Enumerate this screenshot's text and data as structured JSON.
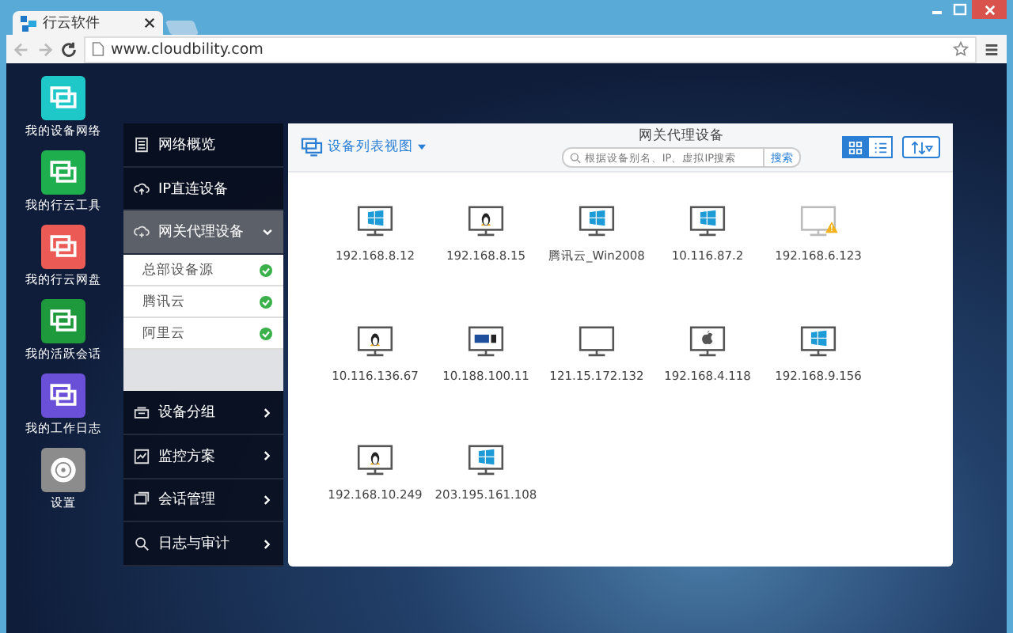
{
  "browser": {
    "tab_title": "行云软件",
    "url": "www.cloudbility.com"
  },
  "desktop_apps": [
    {
      "label": "我的设备网络",
      "color": "#1ec8c8"
    },
    {
      "label": "我的行云工具",
      "color": "#1fae4e"
    },
    {
      "label": "我的行云网盘",
      "color": "#ec5a55"
    },
    {
      "label": "我的活跃会话",
      "color": "#1e9a3c"
    },
    {
      "label": "我的工作日志",
      "color": "#6a4fd8"
    },
    {
      "label": "设置",
      "color": "#8c8c8c"
    }
  ],
  "menu": [
    {
      "label": "网络概览",
      "kind": "plain"
    },
    {
      "label": "IP直连设备",
      "kind": "plain"
    },
    {
      "label": "网关代理设备",
      "kind": "group",
      "expanded": true,
      "children": [
        {
          "label": "总部设备源",
          "checked": true
        },
        {
          "label": "腾讯云",
          "checked": true
        },
        {
          "label": "阿里云",
          "checked": true
        }
      ]
    },
    {
      "label": "设备分组",
      "kind": "group",
      "expanded": false
    },
    {
      "label": "监控方案",
      "kind": "group",
      "expanded": false
    },
    {
      "label": "会话管理",
      "kind": "group",
      "expanded": false
    },
    {
      "label": "日志与审计",
      "kind": "group",
      "expanded": false
    }
  ],
  "panel": {
    "view_menu": "设备列表视图",
    "title": "网关代理设备",
    "search": {
      "placeholder": "根据设备别名、IP、虚拟IP搜索",
      "button": "搜索"
    },
    "view_toggle": [
      {
        "kind": "grid",
        "selected": true
      },
      {
        "kind": "list",
        "selected": false
      }
    ],
    "devices": [
      {
        "name": "192.168.8.12",
        "kind": "windows",
        "warning": false
      },
      {
        "name": "192.168.8.15",
        "kind": "linux",
        "warning": false
      },
      {
        "name": "腾讯云_Win2008",
        "kind": "windows",
        "warning": false
      },
      {
        "name": "10.116.87.2",
        "kind": "windows",
        "warning": false
      },
      {
        "name": "192.168.6.123",
        "kind": "offline",
        "warning": true
      },
      {
        "name": "10.116.136.67",
        "kind": "linux",
        "warning": false
      },
      {
        "name": "10.188.100.11",
        "kind": "aix",
        "warning": false
      },
      {
        "name": "121.15.172.132",
        "kind": "generic",
        "warning": false
      },
      {
        "name": "192.168.4.118",
        "kind": "apple",
        "warning": false
      },
      {
        "name": "192.168.9.156",
        "kind": "windows",
        "warning": false
      },
      {
        "name": "192.168.10.249",
        "kind": "linux",
        "warning": false
      },
      {
        "name": "203.195.161.108",
        "kind": "windows",
        "warning": false
      }
    ]
  }
}
